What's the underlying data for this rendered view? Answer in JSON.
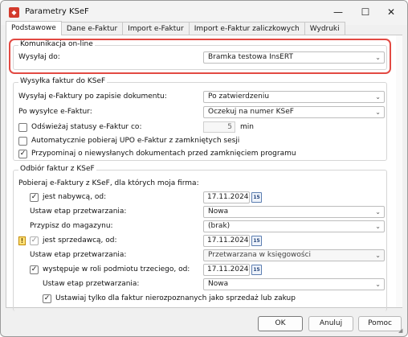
{
  "window": {
    "title": "Parametry KSeF",
    "controls": {
      "minimize": "—",
      "maximize": "☐",
      "close": "✕"
    }
  },
  "tabs": [
    {
      "label": "Podstawowe",
      "active": true
    },
    {
      "label": "Dane e-Faktur",
      "active": false
    },
    {
      "label": "Import e-Faktur",
      "active": false
    },
    {
      "label": "Import e-Faktur zaliczkowych",
      "active": false
    },
    {
      "label": "Wydruki",
      "active": false
    }
  ],
  "online": {
    "legend": "Komunikacja on-line",
    "send_to_label": "Wysyłaj do:",
    "send_to_value": "Bramka testowa InsERT"
  },
  "sending": {
    "legend": "Wysyłka faktur do KSeF",
    "after_save_label": "Wysyłaj e-Faktury po zapisie dokumentu:",
    "after_save_value": "Po zatwierdzeniu",
    "after_send_label": "Po wysyłce e-Faktur:",
    "after_send_value": "Oczekuj na numer KSeF",
    "refresh_label": "Odświeżaj statusy e-Faktur co:",
    "refresh_value": "5",
    "refresh_unit": "min",
    "refresh_checked": false,
    "auto_upo_label": "Automatycznie pobieraj UPO e-Faktur z zamkniętych sesji",
    "auto_upo_checked": false,
    "remind_label": "Przypominaj o niewysłanych dokumentach przed zamknięciem programu",
    "remind_checked": true
  },
  "receiving": {
    "legend": "Odbiór faktur z KSeF",
    "intro": "Pobieraj e-Faktury z KSeF, dla których moja firma:",
    "buyer_label": "jest nabywcą, od:",
    "buyer_checked": true,
    "buyer_date": "17.11.2024",
    "buyer_stage_label": "Ustaw etap przetwarzania:",
    "buyer_stage_value": "Nowa",
    "warehouse_label": "Przypisz do magazynu:",
    "warehouse_value": "(brak)",
    "seller_label": "jest sprzedawcą, od:",
    "seller_checked": true,
    "seller_date": "17.11.2024",
    "seller_stage_label": "Ustaw etap przetwarzania:",
    "seller_stage_value": "Przetwarzana w księgowości",
    "third_label": "występuje w roli podmiotu trzeciego, od:",
    "third_checked": true,
    "third_date": "17.11.2024",
    "third_stage_label": "Ustaw etap przetwarzania:",
    "third_stage_value": "Nowa",
    "unrecognized_label": "Ustawiaj tylko dla faktur nierozpoznanych jako sprzedaż lub zakup",
    "unrecognized_checked": true,
    "calendar_day": "15"
  },
  "footer": {
    "ok": "OK",
    "cancel": "Anuluj",
    "help": "Pomoc"
  },
  "colors": {
    "highlight": "#e24a43",
    "app_icon": "#d33a2c"
  }
}
